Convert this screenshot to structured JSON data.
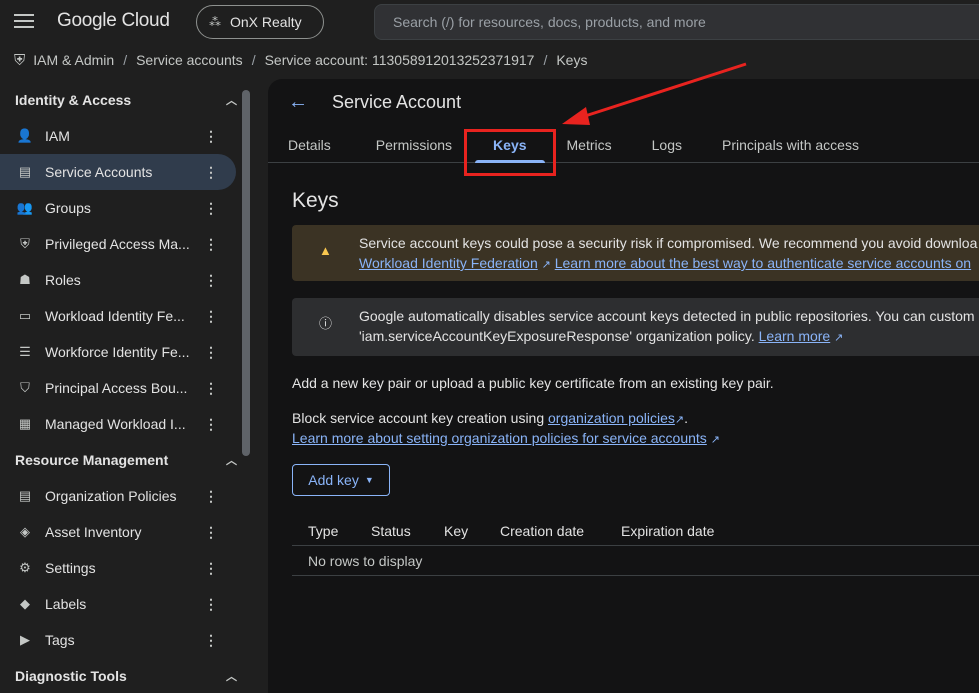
{
  "topbar": {
    "logo": "Google Cloud",
    "project": "OnX Realty",
    "search_placeholder": "Search (/) for resources, docs, products, and more"
  },
  "breadcrumb": [
    "IAM & Admin",
    "Service accounts",
    "Service account: 113058912013252371917",
    "Keys"
  ],
  "sidebar": {
    "sections": [
      {
        "title": "Identity & Access",
        "items": [
          {
            "label": "IAM",
            "icon": "person-add-icon"
          },
          {
            "label": "Service Accounts",
            "icon": "service-account-icon",
            "active": true
          },
          {
            "label": "Groups",
            "icon": "groups-icon"
          },
          {
            "label": "Privileged Access Ma...",
            "icon": "shield-icon"
          },
          {
            "label": "Roles",
            "icon": "roles-icon"
          },
          {
            "label": "Workload Identity Fe...",
            "icon": "id-card-icon"
          },
          {
            "label": "Workforce Identity Fe...",
            "icon": "list-icon"
          },
          {
            "label": "Principal Access Bou...",
            "icon": "policy-icon"
          },
          {
            "label": "Managed Workload I...",
            "icon": "grid-icon"
          }
        ]
      },
      {
        "title": "Resource Management",
        "items": [
          {
            "label": "Organization Policies",
            "icon": "document-icon"
          },
          {
            "label": "Asset Inventory",
            "icon": "diamond-icon"
          },
          {
            "label": "Settings",
            "icon": "gear-icon"
          },
          {
            "label": "Labels",
            "icon": "label-icon"
          },
          {
            "label": "Tags",
            "icon": "tag-icon"
          }
        ]
      },
      {
        "title": "Diagnostic Tools",
        "items": []
      }
    ]
  },
  "main": {
    "title": "Service Account",
    "tabs": [
      "Details",
      "Permissions",
      "Keys",
      "Metrics",
      "Logs",
      "Principals with access"
    ],
    "active_tab": "Keys",
    "heading": "Keys",
    "warning": {
      "line1": "Service account keys could pose a security risk if compromised. We recommend you avoid downloa",
      "link1": "Workload Identity Federation",
      "link2": "Learn more about the best way to authenticate service accounts on"
    },
    "info": {
      "line1": "Google automatically disables service account keys detected in public repositories. You can custom",
      "line2": "'iam.serviceAccountKeyExposureResponse' organization policy.",
      "link": "Learn more"
    },
    "para1": "Add a new key pair or upload a public key certificate from an existing key pair.",
    "para2_prefix": "Block service account key creation using",
    "para2_link": "organization policies",
    "para2_suffix": ".",
    "para3_link": "Learn more about setting organization policies for service accounts",
    "add_key": "Add key",
    "table": {
      "columns": [
        "Type",
        "Status",
        "Key",
        "Creation date",
        "Expiration date"
      ],
      "empty": "No rows to display"
    }
  },
  "colors": {
    "accent": "#8ab4f8",
    "annotation": "#e8231f",
    "warning_bg": "#3b3324"
  }
}
